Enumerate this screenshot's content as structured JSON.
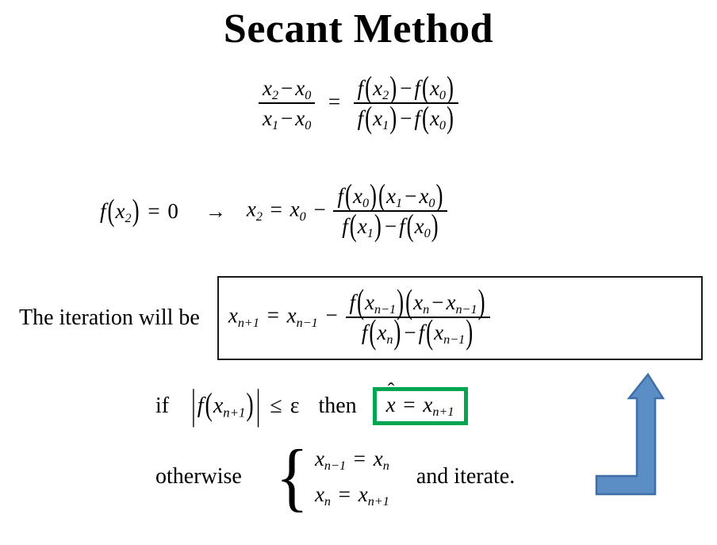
{
  "slide": {
    "title": "Secant Method",
    "background_color": "#ffffff",
    "text_color": "#000000"
  },
  "equation_one": {
    "left": {
      "numerator": "x2 - x0",
      "denominator": "x1 - x0"
    },
    "relation": "=",
    "right": {
      "numerator": "f(x2) - f(x0)",
      "denominator": "f(x1) - f(x0)"
    },
    "plain": "(x2 - x0)/(x1 - x0) = (f(x2) - f(x0))/(f(x1) - f(x0))"
  },
  "equation_two": {
    "condition": "f(x2) = 0",
    "arrow": "→",
    "result_plain": "x2 = x0 - f(x0)(x1 - x0)/(f(x1) - f(x0))",
    "lhs": "x2",
    "equals": "=",
    "first_term": "x0",
    "minus": "-",
    "numerator": "f(x0)(x1 - x0)",
    "denominator": "f(x1) - f(x0)"
  },
  "iteration": {
    "label": "The iteration will be",
    "box_border_color": "#1a1a1a",
    "formula_plain": "x_{n+1} = x_{n-1} - f(x_{n-1})(x_n - x_{n-1}) / (f(x_n) - f(x_{n-1}))",
    "lhs": "x",
    "lhs_sub": "n+1",
    "equals": "=",
    "first_term": "x",
    "first_term_sub": "n-1",
    "minus": "-",
    "numerator": "f(x_{n-1})(x_n - x_{n-1})",
    "denominator": "f(x_n) - f(x_{n-1})"
  },
  "condition_line": {
    "if_keyword": "if",
    "abs_bar": "|",
    "function": "f",
    "arg": "x",
    "arg_sub": "n+1",
    "inequality": "≤",
    "tolerance": "ε",
    "then_keyword": "then",
    "result": {
      "hat": "ˆ",
      "variable": "x",
      "equals": "=",
      "rhs": "x",
      "rhs_sub": "n+1",
      "plain": "x̂ = x_{n+1}",
      "border_color": "#00a550"
    }
  },
  "otherwise_line": {
    "keyword": "otherwise",
    "brace": "{",
    "cases": [
      {
        "lhs": "x",
        "lhs_sub": "n-1",
        "equals": "=",
        "rhs": "x",
        "rhs_sub": "n",
        "plain": "x_{n-1} = x_n"
      },
      {
        "lhs": "x",
        "lhs_sub": "n",
        "equals": "=",
        "rhs": "x",
        "rhs_sub": "n+1",
        "plain": "x_n = x_{n+1}"
      }
    ],
    "trailing_text": "and iterate."
  },
  "feedback_arrow": {
    "shape": "bent-up-arrow",
    "fill_color": "#5b8ec4",
    "stroke_color": "#3f6fa8",
    "direction": "up"
  },
  "symbols": {
    "paren_open": "(",
    "paren_close": ")",
    "minus": "−",
    "equals": "=",
    "zero": "0"
  }
}
